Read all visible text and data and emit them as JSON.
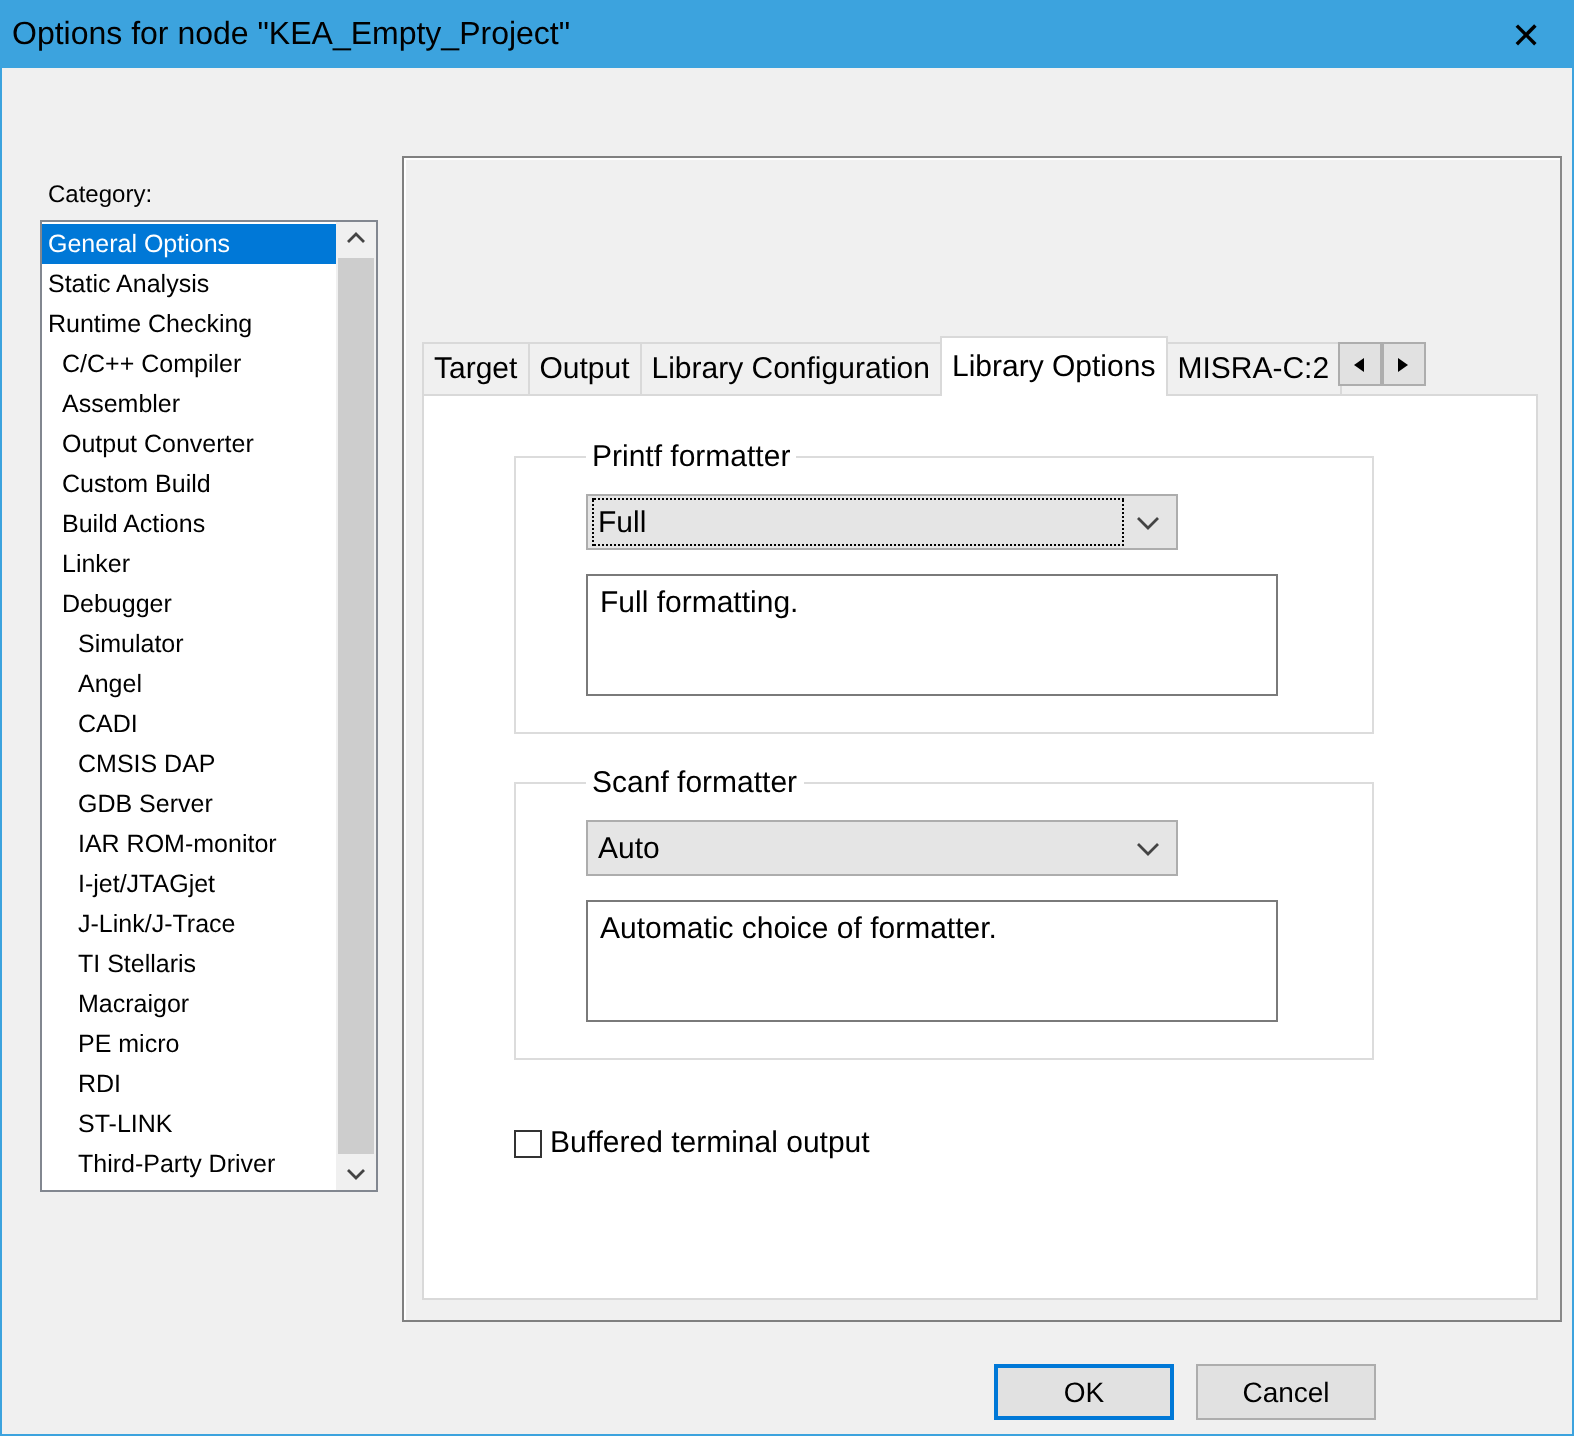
{
  "window": {
    "title": "Options for node \"KEA_Empty_Project\"",
    "close": "✕"
  },
  "category": {
    "label": "Category:",
    "items": [
      {
        "label": "General Options",
        "selected": true
      },
      {
        "label": "Static Analysis",
        "selected": false
      },
      {
        "label": "Runtime Checking",
        "selected": false,
        "children": [
          {
            "label": "C/C++ Compiler",
            "selected": false
          },
          {
            "label": "Assembler",
            "selected": false
          },
          {
            "label": "Output Converter",
            "selected": false
          },
          {
            "label": "Custom Build",
            "selected": false
          },
          {
            "label": "Build Actions",
            "selected": false
          },
          {
            "label": "Linker",
            "selected": false
          },
          {
            "label": "Debugger",
            "selected": false,
            "children": [
              {
                "label": "Simulator",
                "selected": false
              },
              {
                "label": "Angel",
                "selected": false
              },
              {
                "label": "CADI",
                "selected": false
              },
              {
                "label": "CMSIS DAP",
                "selected": false
              },
              {
                "label": "GDB Server",
                "selected": false
              },
              {
                "label": "IAR ROM-monitor",
                "selected": false
              },
              {
                "label": "I-jet/JTAGjet",
                "selected": false
              },
              {
                "label": "J-Link/J-Trace",
                "selected": false
              },
              {
                "label": "TI Stellaris",
                "selected": false
              },
              {
                "label": "Macraigor",
                "selected": false
              },
              {
                "label": "PE micro",
                "selected": false
              },
              {
                "label": "RDI",
                "selected": false
              },
              {
                "label": "ST-LINK",
                "selected": false
              },
              {
                "label": "Third-Party Driver",
                "selected": false
              }
            ]
          }
        ]
      }
    ]
  },
  "tabs": [
    {
      "label": "Target",
      "selected": false
    },
    {
      "label": "Output",
      "selected": false
    },
    {
      "label": "Library Configuration",
      "selected": false
    },
    {
      "label": "Library Options",
      "selected": true
    },
    {
      "label": "MISRA-C:2",
      "selected": false
    }
  ],
  "groups": [
    {
      "title": "Printf formatter",
      "dropdown": {
        "value": "Full",
        "focused": true
      },
      "description": "Full formatting."
    },
    {
      "title": "Scanf formatter",
      "dropdown": {
        "value": "Auto",
        "focused": false
      },
      "description": "Automatic choice of formatter."
    }
  ],
  "checkbox": {
    "label": "Buffered terminal output",
    "checked": false
  },
  "buttons": [
    {
      "label": "OK",
      "default": true
    },
    {
      "label": "Cancel",
      "default": false
    }
  ]
}
